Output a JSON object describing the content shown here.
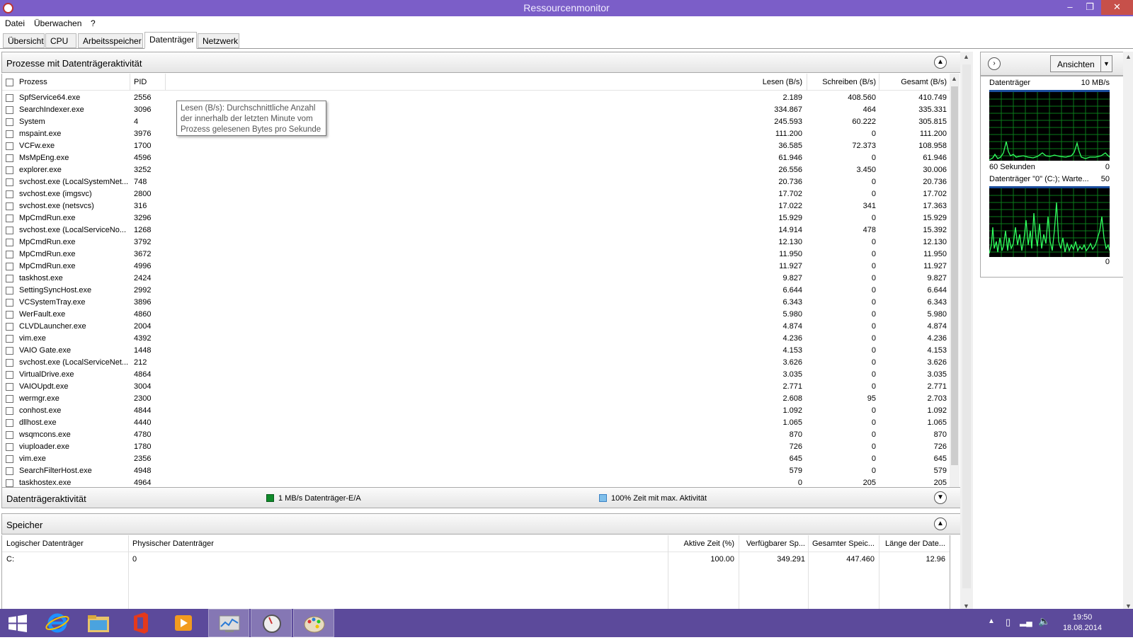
{
  "window": {
    "title": "Ressourcenmonitor",
    "minimize": "–",
    "maximize": "❐",
    "close": "✕"
  },
  "menu": [
    "Datei",
    "Überwachen",
    "?"
  ],
  "tabs": [
    "Übersicht",
    "CPU",
    "Arbeitsspeicher",
    "Datenträger",
    "Netzwerk"
  ],
  "active_tab": "Datenträger",
  "processes": {
    "title": "Prozesse mit Datenträgeraktivität",
    "columns": {
      "process": "Prozess",
      "pid": "PID",
      "read": "Lesen (B/s)",
      "write": "Schreiben (B/s)",
      "total": "Gesamt (B/s)"
    },
    "rows": [
      [
        "SpfService64.exe",
        "2556",
        "2.189",
        "408.560",
        "410.749"
      ],
      [
        "SearchIndexer.exe",
        "3096",
        "334.867",
        "464",
        "335.331"
      ],
      [
        "System",
        "4",
        "245.593",
        "60.222",
        "305.815"
      ],
      [
        "mspaint.exe",
        "3976",
        "111.200",
        "0",
        "111.200"
      ],
      [
        "VCFw.exe",
        "1700",
        "36.585",
        "72.373",
        "108.958"
      ],
      [
        "MsMpEng.exe",
        "4596",
        "61.946",
        "0",
        "61.946"
      ],
      [
        "explorer.exe",
        "3252",
        "26.556",
        "3.450",
        "30.006"
      ],
      [
        "svchost.exe (LocalSystemNet...",
        "748",
        "20.736",
        "0",
        "20.736"
      ],
      [
        "svchost.exe (imgsvc)",
        "2800",
        "17.702",
        "0",
        "17.702"
      ],
      [
        "svchost.exe (netsvcs)",
        "316",
        "17.022",
        "341",
        "17.363"
      ],
      [
        "MpCmdRun.exe",
        "3296",
        "15.929",
        "0",
        "15.929"
      ],
      [
        "svchost.exe (LocalServiceNo...",
        "1268",
        "14.914",
        "478",
        "15.392"
      ],
      [
        "MpCmdRun.exe",
        "3792",
        "12.130",
        "0",
        "12.130"
      ],
      [
        "MpCmdRun.exe",
        "3672",
        "11.950",
        "0",
        "11.950"
      ],
      [
        "MpCmdRun.exe",
        "4996",
        "11.927",
        "0",
        "11.927"
      ],
      [
        "taskhost.exe",
        "2424",
        "9.827",
        "0",
        "9.827"
      ],
      [
        "SettingSyncHost.exe",
        "2992",
        "6.644",
        "0",
        "6.644"
      ],
      [
        "VCSystemTray.exe",
        "3896",
        "6.343",
        "0",
        "6.343"
      ],
      [
        "WerFault.exe",
        "4860",
        "5.980",
        "0",
        "5.980"
      ],
      [
        "CLVDLauncher.exe",
        "2004",
        "4.874",
        "0",
        "4.874"
      ],
      [
        "vim.exe",
        "4392",
        "4.236",
        "0",
        "4.236"
      ],
      [
        "VAIO Gate.exe",
        "1448",
        "4.153",
        "0",
        "4.153"
      ],
      [
        "svchost.exe (LocalServiceNet...",
        "212",
        "3.626",
        "0",
        "3.626"
      ],
      [
        "VirtualDrive.exe",
        "4864",
        "3.035",
        "0",
        "3.035"
      ],
      [
        "VAIOUpdt.exe",
        "3004",
        "2.771",
        "0",
        "2.771"
      ],
      [
        "wermgr.exe",
        "2300",
        "2.608",
        "95",
        "2.703"
      ],
      [
        "conhost.exe",
        "4844",
        "1.092",
        "0",
        "1.092"
      ],
      [
        "dllhost.exe",
        "4440",
        "1.065",
        "0",
        "1.065"
      ],
      [
        "wsqmcons.exe",
        "4780",
        "870",
        "0",
        "870"
      ],
      [
        "viuploader.exe",
        "1780",
        "726",
        "0",
        "726"
      ],
      [
        "vim.exe",
        "2356",
        "645",
        "0",
        "645"
      ],
      [
        "SearchFilterHost.exe",
        "4948",
        "579",
        "0",
        "579"
      ],
      [
        "taskhostex.exe",
        "4964",
        "0",
        "205",
        "205"
      ]
    ]
  },
  "tooltip": {
    "line1": "Lesen (B/s): Durchschnittliche Anzahl",
    "line2": "der innerhalb der letzten Minute vom",
    "line3": "Prozess gelesenen Bytes pro Sekunde"
  },
  "disk_activity": {
    "title": "Datenträgeraktivität",
    "legend_io": "1 MB/s Datenträger-E/A",
    "legend_time": "100% Zeit mit max. Aktivität",
    "io_color": "#0f8a2a",
    "time_color": "#7fbfea"
  },
  "storage": {
    "title": "Speicher",
    "columns": {
      "logical": "Logischer Datenträger",
      "physical": "Physischer Datenträger",
      "active": "Aktive Zeit (%)",
      "available": "Verfügbarer Sp...",
      "total": "Gesamter Speic...",
      "queue": "Länge der Date..."
    },
    "rows": [
      [
        "C:",
        "0",
        "100.00",
        "349.291",
        "447.460",
        "12.96"
      ]
    ]
  },
  "graphs": {
    "views_button": "Ansichten",
    "g1": {
      "title": "Datenträger",
      "max": "10 MB/s",
      "foot_left": "60 Sekunden",
      "foot_right": "0"
    },
    "g2": {
      "title": "Datenträger \"0\" (C:); Warte...",
      "max": "50",
      "foot_right": "0"
    }
  },
  "taskbar": {
    "icons": [
      "windows-start-icon",
      "internet-explorer-icon",
      "file-explorer-icon",
      "office-icon",
      "media-player-icon",
      "performance-monitor-icon",
      "resource-monitor-icon",
      "paint-icon"
    ],
    "time": "19:50",
    "date": "18.08.2014"
  }
}
